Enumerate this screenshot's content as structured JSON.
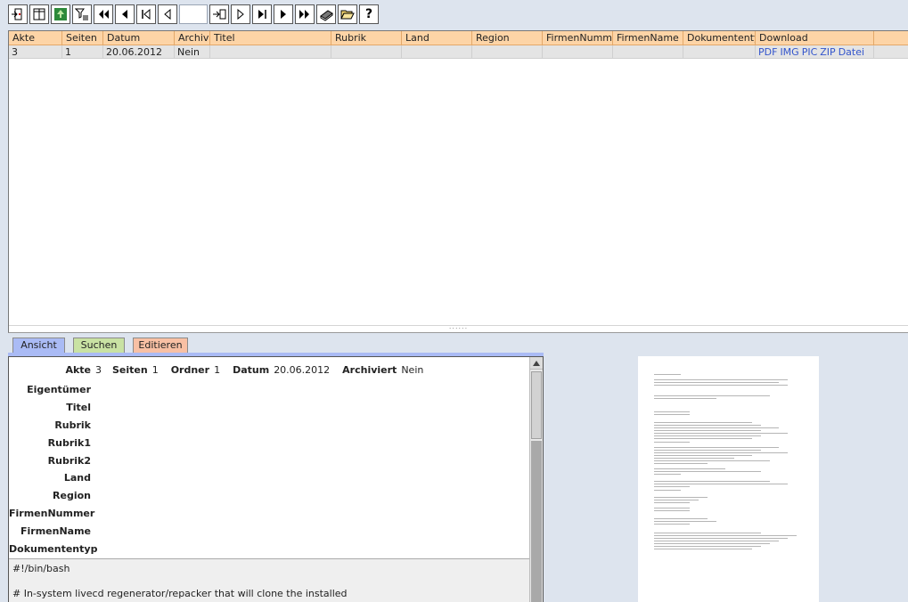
{
  "toolbar": {
    "buttons": [
      {
        "name": "exit-icon"
      },
      {
        "name": "columns-icon"
      },
      {
        "name": "tree-icon"
      },
      {
        "name": "filter-icon"
      },
      {
        "name": "first-page-icon"
      },
      {
        "name": "prev-page-icon"
      },
      {
        "name": "first-record-icon"
      },
      {
        "name": "prev-record-icon"
      }
    ],
    "page_input_value": "",
    "buttons_after": [
      {
        "name": "goto-icon"
      },
      {
        "name": "next-record-icon"
      },
      {
        "name": "last-record-icon"
      },
      {
        "name": "next-page-icon"
      },
      {
        "name": "last-page-icon"
      },
      {
        "name": "scanner-icon"
      },
      {
        "name": "folder-open-icon"
      },
      {
        "name": "help-icon",
        "glyph": "?"
      }
    ]
  },
  "grid": {
    "columns": [
      "Akte",
      "Seiten",
      "Datum",
      "Archivi",
      "Titel",
      "Rubrik",
      "Land",
      "Region",
      "FirmenNummer",
      "FirmenName",
      "Dokumententyp",
      "Download"
    ],
    "rows": [
      {
        "cells": [
          "3",
          "1",
          "20.06.2012",
          "Nein",
          "",
          "",
          "",
          "",
          "",
          "",
          ""
        ],
        "downloads": [
          "PDF",
          "IMG",
          "PIC",
          "ZIP",
          "Datei"
        ]
      }
    ],
    "splitter_grip": "......"
  },
  "tabs": [
    {
      "label": "Ansicht",
      "active": true
    },
    {
      "label": "Suchen",
      "active": false
    },
    {
      "label": "Editieren",
      "active": false
    }
  ],
  "detail": {
    "top": {
      "akte_label": "Akte",
      "akte_value": "3",
      "seiten_label": "Seiten",
      "seiten_value": "1",
      "ordner_label": "Ordner",
      "ordner_value": "1",
      "datum_label": "Datum",
      "datum_value": "20.06.2012",
      "archiviert_label": "Archiviert",
      "archiviert_value": "Nein"
    },
    "fields": [
      "Eigentümer",
      "Titel",
      "Rubrik",
      "Rubrik1",
      "Rubrik2",
      "Land",
      "Region",
      "FirmenNummer",
      "FirmenName",
      "Dokumententyp"
    ],
    "content_lines": [
      "#!/bin/bash",
      "",
      "# In-system livecd regenerator/repacker that will clone the installed"
    ]
  },
  "colors": {
    "header_bg": "#fdd4a6",
    "tab_ansicht": "#aabbf5",
    "tab_suchen": "#c9e2a3",
    "tab_editieren": "#f8c0a4",
    "link": "#3355cc",
    "page_bg": "#dde4ee"
  }
}
